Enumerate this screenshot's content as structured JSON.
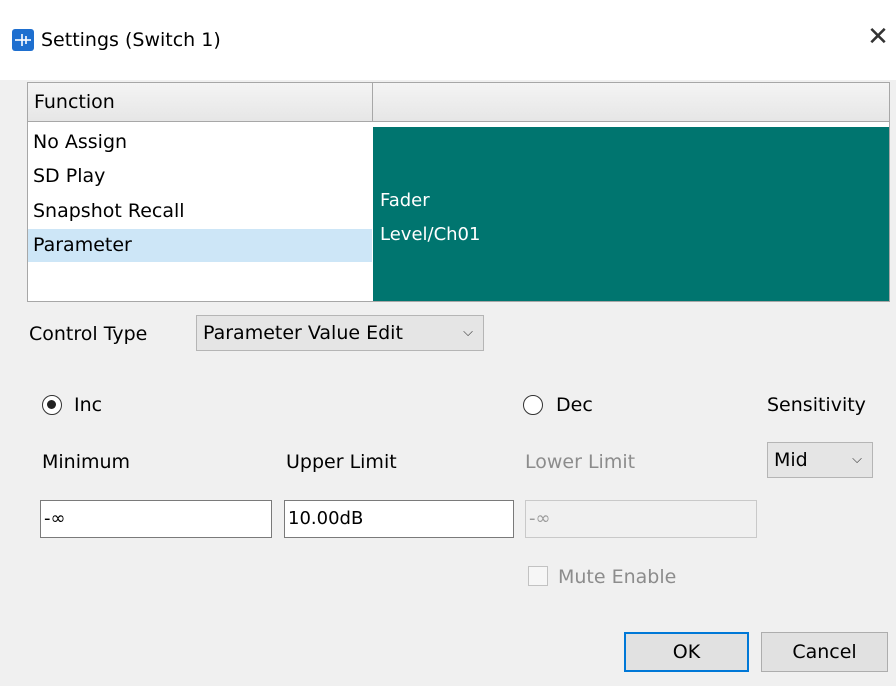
{
  "window": {
    "title": "Settings (Switch 1)",
    "close_glyph": "✕",
    "icon": "app-switch-icon"
  },
  "table": {
    "col1_header": "Function",
    "col2_header": "",
    "functions": [
      {
        "label": "No Assign",
        "selected": false
      },
      {
        "label": "SD Play",
        "selected": false
      },
      {
        "label": "Snapshot Recall",
        "selected": false
      },
      {
        "label": "Parameter",
        "selected": true
      }
    ],
    "detail_line1": "Fader",
    "detail_line2": "Level/Ch01",
    "detail_color": "#00756f"
  },
  "control_type": {
    "label": "Control Type",
    "value": "Parameter Value Edit"
  },
  "mode": {
    "inc_label": "Inc",
    "inc_selected": true,
    "dec_label": "Dec",
    "dec_selected": false
  },
  "sensitivity": {
    "label": "Sensitivity",
    "value": "Mid"
  },
  "fields": {
    "minimum_label": "Minimum",
    "minimum_value": "-∞",
    "upper_label": "Upper Limit",
    "upper_value": "10.00dB",
    "lower_label": "Lower Limit",
    "lower_value": "-∞"
  },
  "mute_enable": {
    "label": "Mute Enable",
    "checked": false
  },
  "buttons": {
    "ok": "OK",
    "cancel": "Cancel"
  }
}
